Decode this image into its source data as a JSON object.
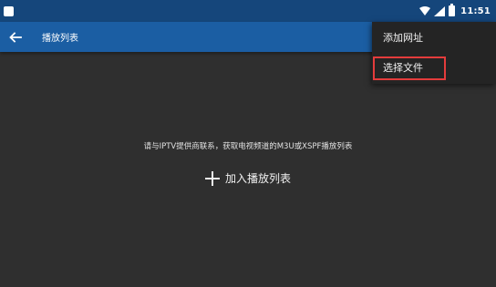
{
  "status_bar": {
    "time": "11:51"
  },
  "toolbar": {
    "title": "播放列表"
  },
  "menu": {
    "items": [
      {
        "label": "添加网址"
      },
      {
        "label": "选择文件",
        "highlighted": true
      }
    ],
    "highlight_color": "#e43c3c"
  },
  "main": {
    "hint": "请与IPTV提供商联系，获取电视频道的M3U或XSPF播放列表",
    "add_label": "加入播放列表"
  },
  "colors": {
    "status_bar": "#15467b",
    "toolbar": "#1b5ea3",
    "background": "#2f2f2f",
    "menu": "#242424"
  },
  "icons": [
    "notification-icon",
    "wifi-icon",
    "signal-icon",
    "battery-icon",
    "back-arrow-icon",
    "plus-icon"
  ]
}
